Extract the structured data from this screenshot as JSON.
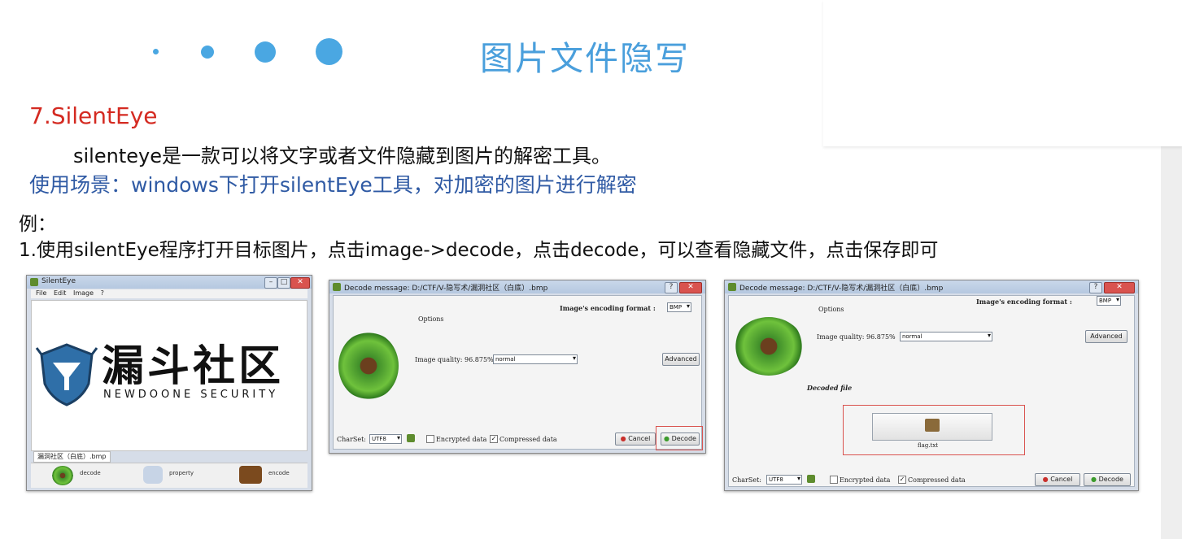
{
  "slide": {
    "title": "图片文件隐写",
    "section_heading": "7.SilentEye",
    "description": "silenteye是一款可以将文字或者文件隐藏到图片的解密工具。",
    "usage": "使用场景：windows下打开silentEye工具，对加密的图片进行解密",
    "example_label": "例：",
    "step": "1.使用silentEye程序打开目标图片，点击image->decode，点击decode，可以查看隐藏文件，点击保存即可"
  },
  "window1": {
    "title": "SilentEye",
    "menu": [
      "File",
      "Edit",
      "Image",
      "?"
    ],
    "logo_cn": "漏斗社区",
    "logo_en": "NEWDOONE SECURITY",
    "file_tab": "漏洞社区（白底）.bmp",
    "tools": [
      "decode",
      "property",
      "encode"
    ]
  },
  "window2": {
    "title": "Decode message: D:/CTF/V-隐写术/漏洞社区（白底）.bmp",
    "encoding_format_label": "Image's encoding format :",
    "encoding_format_value": "BMP",
    "options_label": "Options",
    "image_quality_label": "Image quality: 96.875%",
    "image_quality_value": "normal",
    "advanced_button": "Advanced",
    "charset_label": "CharSet:",
    "charset_value": "UTF8",
    "encrypted_label": "Encrypted data",
    "compressed_label": "Compressed data",
    "cancel_button": "Cancel",
    "decode_button": "Decode"
  },
  "window3": {
    "title": "Decode message: D:/CTF/V-隐写术/漏洞社区（白底）.bmp",
    "encoding_format_label": "Image's encoding format :",
    "encoding_format_value": "BMP",
    "options_label": "Options",
    "image_quality_label": "Image quality: 96.875%",
    "image_quality_value": "normal",
    "advanced_button": "Advanced",
    "decoded_file_label": "Decoded file",
    "file_name": "flag.txt",
    "charset_label": "CharSet:",
    "charset_value": "UTF8",
    "encrypted_label": "Encrypted data",
    "compressed_label": "Compressed data",
    "cancel_button": "Cancel",
    "decode_button": "Decode"
  },
  "colors": {
    "title": "#4a9fdc",
    "heading": "#d42a21",
    "usage": "#2f5aa4",
    "dots": "#4aa7e2"
  }
}
